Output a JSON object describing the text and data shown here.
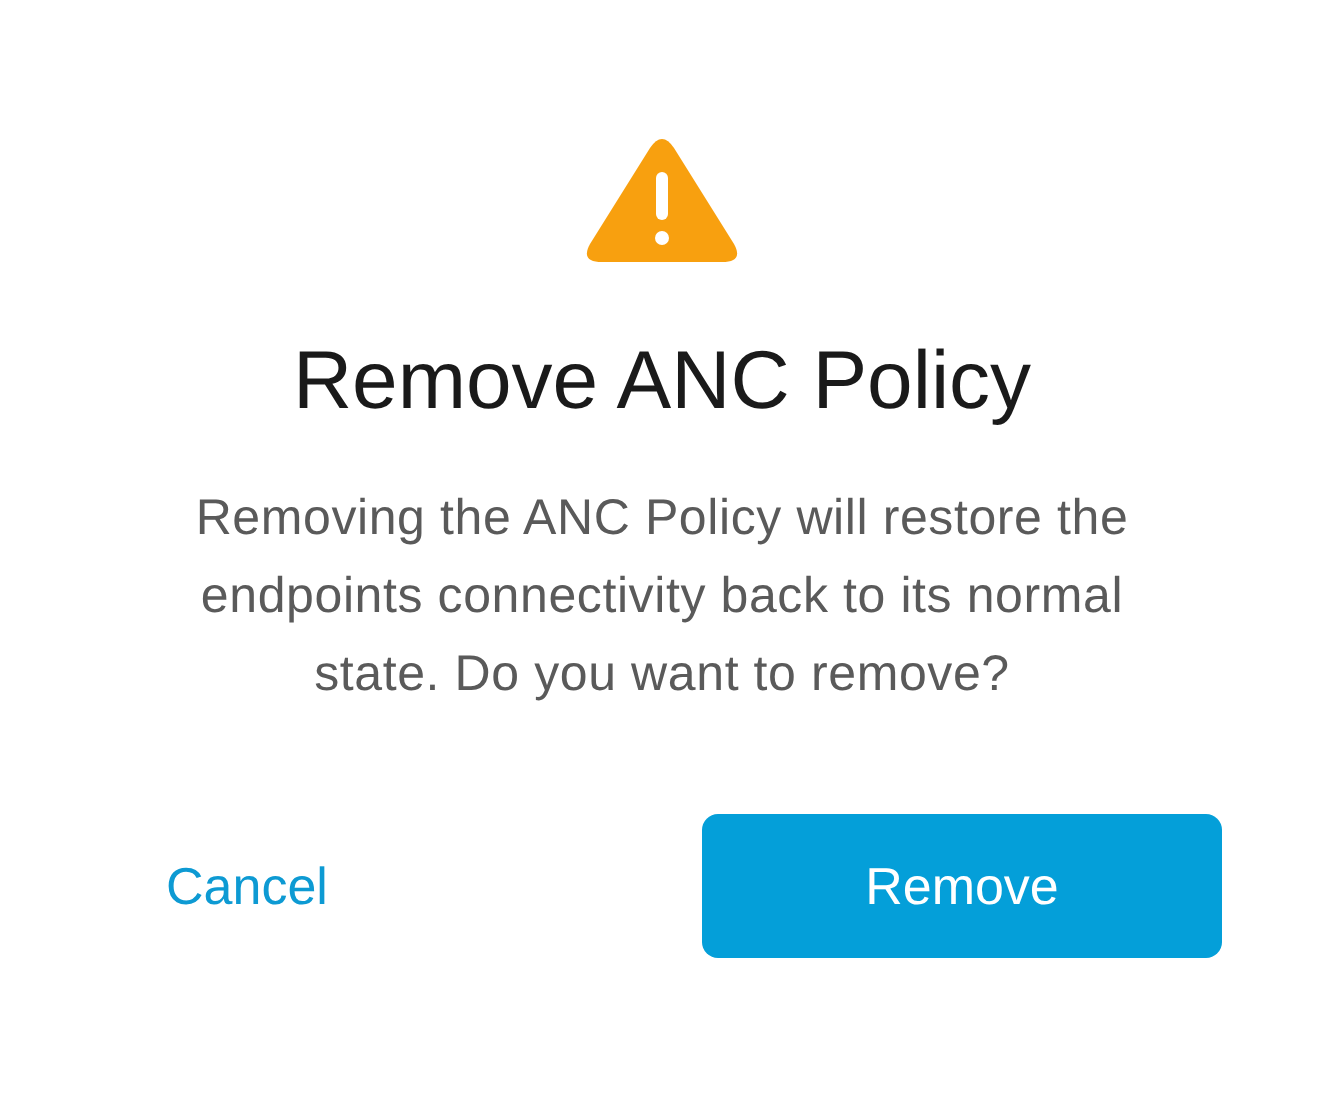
{
  "dialog": {
    "title": "Remove ANC Policy",
    "message": "Removing the ANC Policy will restore the endpoints connectivity back to its normal state. Do you want to remove?",
    "buttons": [
      {
        "label": "Cancel",
        "kind": "link"
      },
      {
        "label": "Remove",
        "kind": "primary"
      }
    ]
  }
}
